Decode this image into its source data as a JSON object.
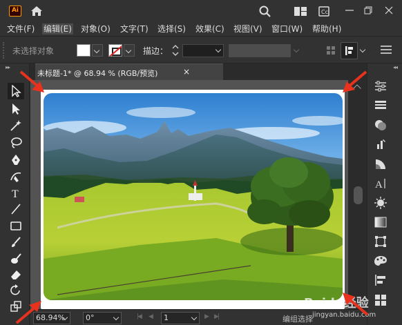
{
  "app": {
    "logo": "Ai",
    "accent": "#ff9a00"
  },
  "menubar": {
    "items": [
      {
        "label": "文件(F)"
      },
      {
        "label": "编辑(E)"
      },
      {
        "label": "对象(O)"
      },
      {
        "label": "文字(T)"
      },
      {
        "label": "选择(S)"
      },
      {
        "label": "效果(C)"
      },
      {
        "label": "视图(V)"
      },
      {
        "label": "窗口(W)"
      },
      {
        "label": "帮助(H)"
      }
    ]
  },
  "control_bar": {
    "selection_status": "未选择对象",
    "fill_color": "#ffffff",
    "stroke_label": "描边："
  },
  "document": {
    "tab_title": "未标题-1* @ 68.94 % (RGB/预览)",
    "close_glyph": "×"
  },
  "statusbar": {
    "zoom": "68.94%",
    "rotation": "0°",
    "page": "1",
    "status": "编组选择"
  },
  "watermark": {
    "text": "Baidu经验",
    "url": "jingyan.baidu.com"
  },
  "annotations": {
    "arrow_color": "#e8321e"
  },
  "icons": {
    "titlebar": [
      "home-icon",
      "search-icon",
      "workspace-layout-icon",
      "library-icon"
    ],
    "tools": [
      "selection-tool-icon",
      "direct-selection-tool-icon",
      "magic-wand-tool-icon",
      "lasso-tool-icon",
      "pen-tool-icon",
      "curvature-tool-icon",
      "type-tool-icon",
      "line-tool-icon",
      "rectangle-tool-icon",
      "paintbrush-tool-icon",
      "blob-brush-tool-icon",
      "eraser-tool-icon",
      "rotate-tool-icon",
      "scale-tool-icon"
    ],
    "panels": [
      "properties-panel-icon",
      "layers-panel-icon",
      "appearance-panel-icon",
      "brushes-panel-icon",
      "transparency-panel-icon",
      "character-panel-icon",
      "color-panel-icon",
      "gradient-panel-icon",
      "transform-panel-icon",
      "graphic-styles-panel-icon",
      "align-panel-icon"
    ]
  }
}
